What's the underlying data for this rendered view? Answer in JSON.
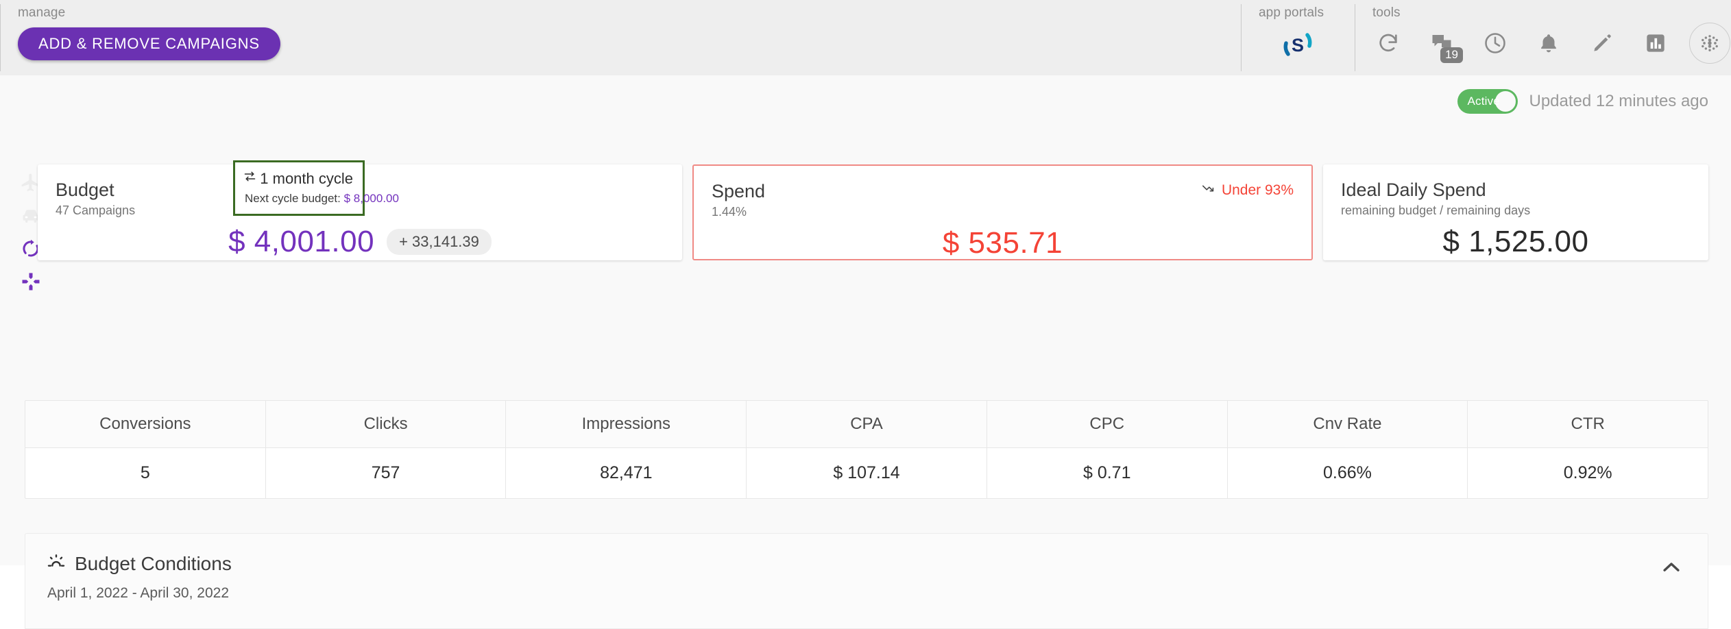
{
  "topbar": {
    "manage": {
      "label": "manage",
      "button_label": "ADD & REMOVE CAMPAIGNS"
    },
    "app_portals": {
      "label": "app portals",
      "logo_name": "sizmek-s-logo"
    },
    "tools": {
      "label": "tools",
      "icons": [
        {
          "name": "refresh-icon"
        },
        {
          "name": "messages-icon",
          "badge": "19"
        },
        {
          "name": "history-clock-icon"
        },
        {
          "name": "notifications-bell-icon"
        },
        {
          "name": "edit-pencil-icon"
        },
        {
          "name": "reports-bar-chart-icon"
        },
        {
          "name": "app-grid-icon"
        }
      ]
    }
  },
  "status": {
    "toggle_label": "Active",
    "toggle_on": true,
    "updated_text": "Updated 12 minutes ago",
    "active_color": "#5cb860"
  },
  "rail": {
    "icons": [
      {
        "name": "airplane-icon",
        "color": "#ececec"
      },
      {
        "name": "car-icon",
        "color": "#ececec"
      },
      {
        "name": "rotate-refresh-icon",
        "color": "#7332bd"
      },
      {
        "name": "expand-arrows-icon",
        "color": "#7332bd"
      }
    ]
  },
  "cards": {
    "budget": {
      "title": "Budget",
      "subtitle": "47 Campaigns",
      "amount": "$ 4,001.00",
      "amount_color": "#7332bd",
      "chip": "+ 33,141.39"
    },
    "cycle": {
      "cycle_label": "1 month cycle",
      "next_label": "Next cycle budget:",
      "next_value": "$ 8,000.00",
      "border_color": "#3b6b23"
    },
    "spend": {
      "title": "Spend",
      "subtitle": "1.44%",
      "trend_label": "Under 93%",
      "amount": "$ 535.71",
      "amount_color": "#f44336",
      "border_color": "#f08a85"
    },
    "ideal": {
      "title": "Ideal Daily Spend",
      "subtitle": "remaining budget / remaining days",
      "amount": "$ 1,525.00",
      "amount_color": "#2b2b2b"
    }
  },
  "metrics": {
    "headers": [
      "Conversions",
      "Clicks",
      "Impressions",
      "CPA",
      "CPC",
      "Cnv Rate",
      "CTR"
    ],
    "values": [
      "5",
      "757",
      "82,471",
      "$ 107.14",
      "$ 0.71",
      "0.66%",
      "0.92%"
    ]
  },
  "conditions": {
    "title": "Budget Conditions",
    "dates": "April 1, 2022  -  April 30, 2022",
    "icon_name": "sun-brightness-icon",
    "collapse_icon": "chevron-up-icon"
  }
}
